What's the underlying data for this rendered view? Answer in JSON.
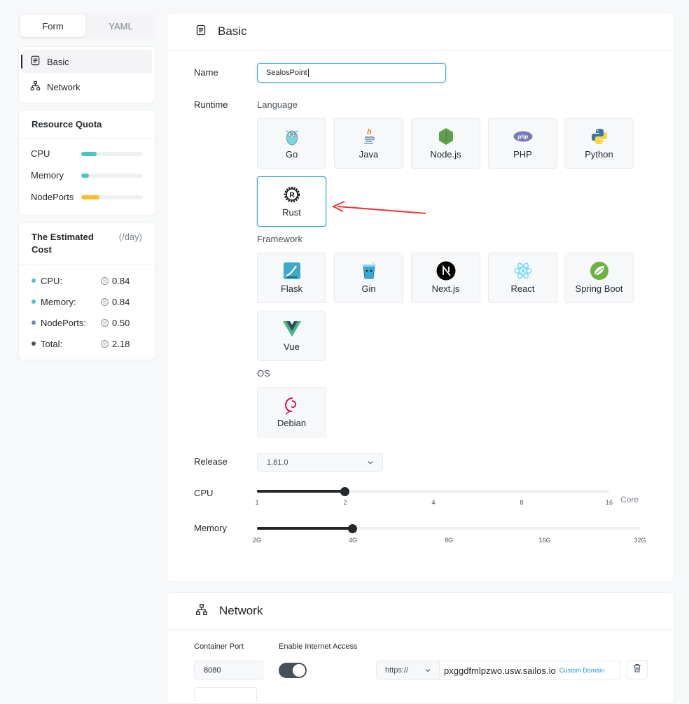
{
  "tabs": [
    {
      "label": "Form",
      "active": true
    },
    {
      "label": "YAML",
      "active": false
    }
  ],
  "nav": {
    "items": [
      {
        "label": "Basic",
        "icon": "document-icon",
        "active": true
      },
      {
        "label": "Network",
        "icon": "network-icon",
        "active": false
      }
    ]
  },
  "quota": {
    "title": "Resource Quota",
    "rows": [
      {
        "label": "CPU",
        "used": 0.25,
        "color": "#46c6c6"
      },
      {
        "label": "Memory",
        "used": 0.12,
        "color": "#46c6c6"
      },
      {
        "label": "NodePorts",
        "used": 0.3,
        "color": "#fbbc2e"
      }
    ]
  },
  "cost": {
    "title": "The Estimated Cost",
    "unit": "(/day)",
    "rows": [
      {
        "label": "CPU:",
        "value": "0.84",
        "color": "#46c6c6"
      },
      {
        "label": "Memory:",
        "value": "0.84",
        "color": "#46c6c6"
      },
      {
        "label": "NodePorts:",
        "value": "0.50",
        "color": "#7184a8"
      },
      {
        "label": "Total:",
        "value": "2.18",
        "color": "#485058"
      }
    ]
  },
  "basic": {
    "title": "Basic",
    "name_label": "Name",
    "name_value": "SealosPoint",
    "runtime_label": "Runtime",
    "language_label": "Language",
    "languages": [
      "Go",
      "Java",
      "Node.js",
      "PHP",
      "Python",
      "Rust"
    ],
    "selected_language": "Rust",
    "framework_label": "Framework",
    "frameworks": [
      "Flask",
      "Gin",
      "Next.js",
      "React",
      "Spring Boot",
      "Vue"
    ],
    "os_label": "OS",
    "os": [
      "Debian"
    ],
    "release_label": "Release",
    "release_value": "1.81.0",
    "cpu_label": "CPU",
    "cpu_ticks": [
      "1",
      "2",
      "4",
      "8",
      "16"
    ],
    "cpu_unit": "Core",
    "cpu_value": "2",
    "memory_label": "Memory",
    "memory_ticks": [
      "2G",
      "4G",
      "8G",
      "16G",
      "32G"
    ],
    "memory_value": "4G"
  },
  "network": {
    "title": "Network",
    "container_port_label": "Container Port",
    "port_value": "8080",
    "internet_label": "Enable Internet Access",
    "internet_enabled": true,
    "protocol": "https://",
    "host": "pxggdfmlpzwo.usw.sailos.io",
    "custom_domain": "Custom Domain"
  },
  "colors": {
    "accent": "#36a2c7",
    "dark": "#24282c"
  }
}
